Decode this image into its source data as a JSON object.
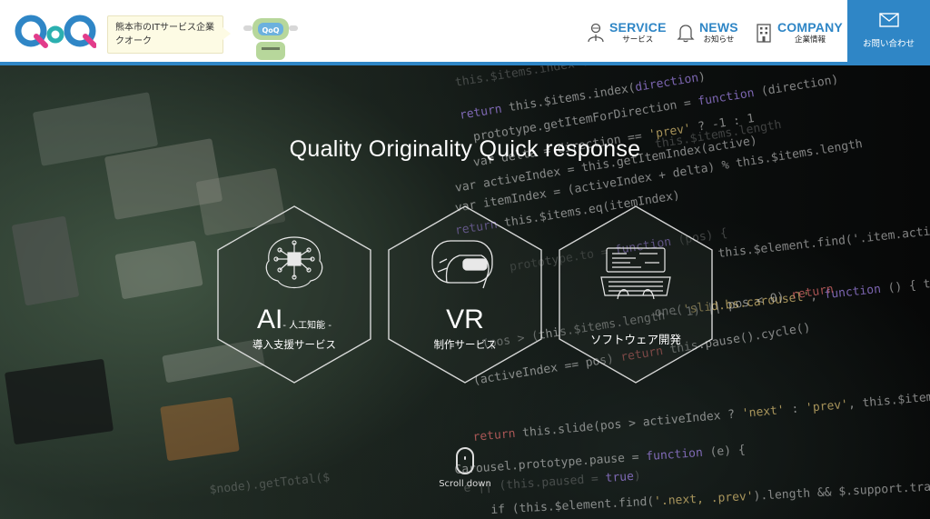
{
  "brand": {
    "logo_text": "QoQ",
    "speech": "熊本市のITサービス企業\nクオーク",
    "robot_badge": "QoQ"
  },
  "nav": {
    "items": [
      {
        "en": "SERVICE",
        "jp": "サービス",
        "icon": "person-icon"
      },
      {
        "en": "NEWS",
        "jp": "お知らせ",
        "icon": "bell-icon"
      },
      {
        "en": "COMPANY",
        "jp": "企業情報",
        "icon": "building-icon"
      }
    ],
    "contact": {
      "label": "お問い合わせ",
      "icon": "mail-icon"
    }
  },
  "hero": {
    "tagline": "Quality Originality Quick response",
    "services": [
      {
        "big": "AI",
        "inline": "- 人工知能 -",
        "sub": "導入支援サービス",
        "icon": "ai-brain-icon"
      },
      {
        "big": "VR",
        "inline": "",
        "sub": "制作サービス",
        "icon": "vr-headset-icon"
      },
      {
        "big": "",
        "inline": "",
        "sub": "ソフトウェア開発",
        "icon": "software-dev-icon"
      }
    ],
    "scroll_label": "Scroll down"
  },
  "colors": {
    "brand": "#2f86c6",
    "header_bg": "#ffffff",
    "speech_bg": "#fdfbe4"
  }
}
